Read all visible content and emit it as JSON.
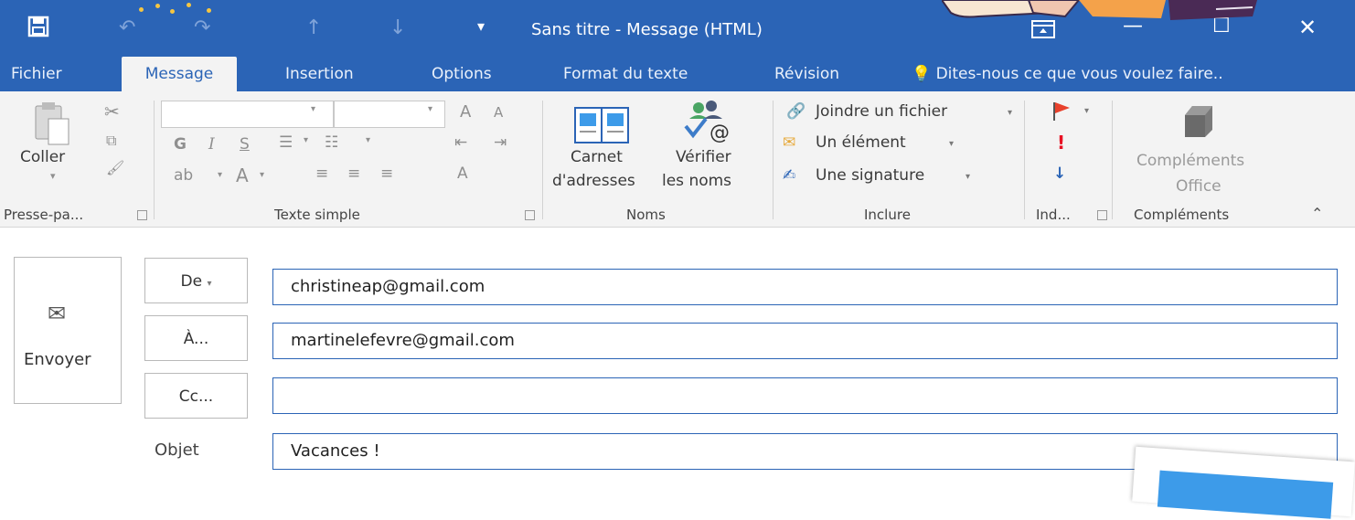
{
  "window": {
    "title": "Sans titre - Message (HTML)",
    "quick_access": [
      "save-icon",
      "undo-icon",
      "redo-icon",
      "up-arrow-icon",
      "down-arrow-icon",
      "customize-icon"
    ],
    "controls": [
      "ribbon-display-icon",
      "minimize-icon",
      "maximize-icon",
      "close-icon"
    ]
  },
  "tabs": [
    {
      "label": "Fichier"
    },
    {
      "label": "Message",
      "active": true
    },
    {
      "label": "Insertion"
    },
    {
      "label": "Options"
    },
    {
      "label": "Format du texte"
    },
    {
      "label": "Révision"
    }
  ],
  "tell_me": "Dites-nous ce que vous voulez faire..",
  "ribbon": {
    "clipboard": {
      "paste": "Coller",
      "label": "Presse-pa..."
    },
    "basic_text": {
      "label": "Texte simple",
      "bold": "G",
      "italic": "I",
      "underline": "S",
      "font_grow": "A",
      "font_shrink": "A",
      "font_color": "A"
    },
    "names": {
      "address_book_1": "Carnet",
      "address_book_2": "d'adresses",
      "check_names_1": "Vérifier",
      "check_names_2": "les noms",
      "label": "Noms"
    },
    "include": {
      "attach": "Joindre un fichier",
      "item": "Un élément",
      "signature": "Une signature",
      "label": "Inclure"
    },
    "tags": {
      "label": "Ind..."
    },
    "addins": {
      "line1": "Compléments",
      "line2": "Office",
      "label": "Compléments"
    }
  },
  "message": {
    "send": "Envoyer",
    "from_btn": "De",
    "to_btn": "À...",
    "cc_btn": "Cc...",
    "subject_label": "Objet",
    "from_value": "christineap@gmail.com",
    "to_value": "martinelefevre@gmail.com",
    "cc_value": "",
    "subject_value": "Vacances !"
  },
  "colors": {
    "accent": "#2b64b6",
    "ribbon_bg": "#f3f3f3",
    "flag": "#e8412c",
    "importance": "#e81123",
    "low": "#2b64b6"
  }
}
